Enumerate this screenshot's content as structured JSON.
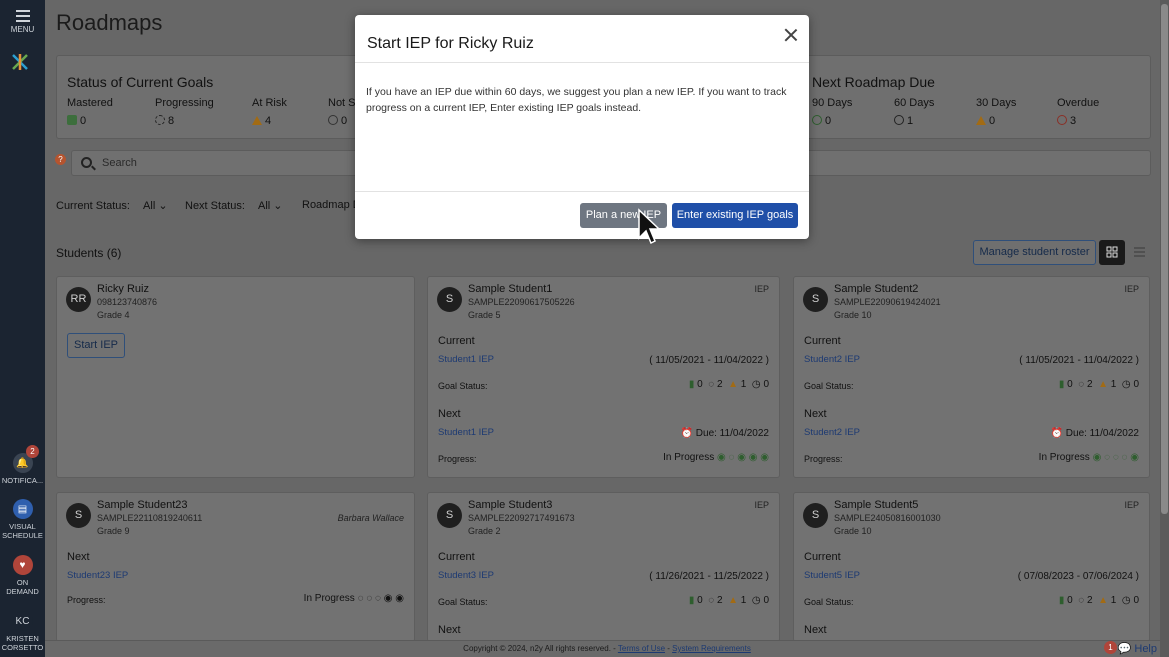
{
  "rail": {
    "menu_label": "MENU",
    "notifications_label": "NOTIFICA...",
    "notifications_badge": "2",
    "visual_schedule_label": "VISUAL SCHEDULE",
    "on_demand_label": "ON DEMAND",
    "user_initials": "KC",
    "user_name": "KRISTEN CORSETTO"
  },
  "page_title": "Roadmaps",
  "status_panel": {
    "title": "Status of Current Goals",
    "stats": [
      {
        "label": "Mastered",
        "value": "0"
      },
      {
        "label": "Progressing",
        "value": "8"
      },
      {
        "label": "At Risk",
        "value": "4"
      },
      {
        "label": "Not S",
        "value": "0"
      }
    ]
  },
  "due_panel": {
    "title": "Next Roadmap Due",
    "stats": [
      {
        "label": "90 Days",
        "value": "0"
      },
      {
        "label": "60 Days",
        "value": "1"
      },
      {
        "label": "30 Days",
        "value": "0"
      },
      {
        "label": "Overdue",
        "value": "3"
      }
    ]
  },
  "search": {
    "placeholder": "Search"
  },
  "filters": {
    "current_status_label": "Current Status:",
    "current_status_value": "All",
    "next_status_label": "Next Status:",
    "next_status_value": "All",
    "roadmap_label": "Roadmap D"
  },
  "students_heading": "Students (6)",
  "manage_roster_label": "Manage student roster",
  "cards": {
    "c1": {
      "initials": "RR",
      "name": "Ricky Ruiz",
      "id": "098123740876",
      "grade": "Grade 4",
      "button": "Start IEP"
    },
    "c2": {
      "name": "Sample Student1",
      "id": "SAMPLE22090617505226",
      "grade": "Grade 5",
      "tag": "IEP",
      "current_label": "Current",
      "current_link": "Student1 IEP",
      "current_range": "( 11/05/2021 - 11/04/2022 )",
      "goal_label": "Goal Status:",
      "g1": "0",
      "g2": "2",
      "g3": "1",
      "g4": "0",
      "next_label": "Next",
      "next_link": "Student1 IEP",
      "due": "Due: 11/04/2022",
      "progress_label": "Progress:",
      "progress_state": "In Progress"
    },
    "c3": {
      "name": "Sample Student2",
      "id": "SAMPLE22090619424021",
      "grade": "Grade 10",
      "tag": "IEP",
      "current_label": "Current",
      "current_link": "Student2 IEP",
      "current_range": "( 11/05/2021 - 11/04/2022 )",
      "goal_label": "Goal Status:",
      "g1": "0",
      "g2": "2",
      "g3": "1",
      "g4": "0",
      "next_label": "Next",
      "next_link": "Student2 IEP",
      "due": "Due: 11/04/2022",
      "progress_label": "Progress:",
      "progress_state": "In Progress"
    },
    "c4": {
      "name": "Sample Student23",
      "id": "SAMPLE22110819240611",
      "grade": "Grade 9",
      "tag": "Barbara Wallace",
      "next_label": "Next",
      "next_link": "Student23 IEP",
      "progress_label": "Progress:",
      "progress_state": "In Progress"
    },
    "c5": {
      "name": "Sample Student3",
      "id": "SAMPLE22092717491673",
      "grade": "Grade 2",
      "tag": "IEP",
      "current_label": "Current",
      "current_link": "Student3 IEP",
      "current_range": "( 11/26/2021 - 11/25/2022 )",
      "goal_label": "Goal Status:",
      "g1": "0",
      "g2": "2",
      "g3": "1",
      "g4": "0",
      "next_label": "Next"
    },
    "c6": {
      "name": "Sample Student5",
      "id": "SAMPLE24050816001030",
      "grade": "Grade 10",
      "tag": "IEP",
      "current_label": "Current",
      "current_link": "Student5 IEP",
      "current_range": "( 07/08/2023 - 07/06/2024 )",
      "goal_label": "Goal Status:",
      "g1": "0",
      "g2": "2",
      "g3": "1",
      "g4": "0",
      "next_label": "Next"
    }
  },
  "footer": {
    "copyright": "Copyright © 2024, n2y All rights reserved. - ",
    "terms": "Terms of Use",
    "sep": " - ",
    "requirements": "System Requirements",
    "help": "Help",
    "help_badge": "1"
  },
  "modal": {
    "title": "Start IEP for Ricky Ruiz",
    "body": "If you have an IEP due within 60 days, we suggest you plan a new IEP. If you want to track progress on a current IEP, Enter existing IEP goals instead.",
    "plan_button": "Plan a new IEP",
    "enter_button": "Enter existing IEP goals"
  },
  "colors": {
    "primary": "#1f4fa8",
    "secondary_button": "#6e7681",
    "rail": "#1b2431",
    "alert": "#b0453a"
  }
}
